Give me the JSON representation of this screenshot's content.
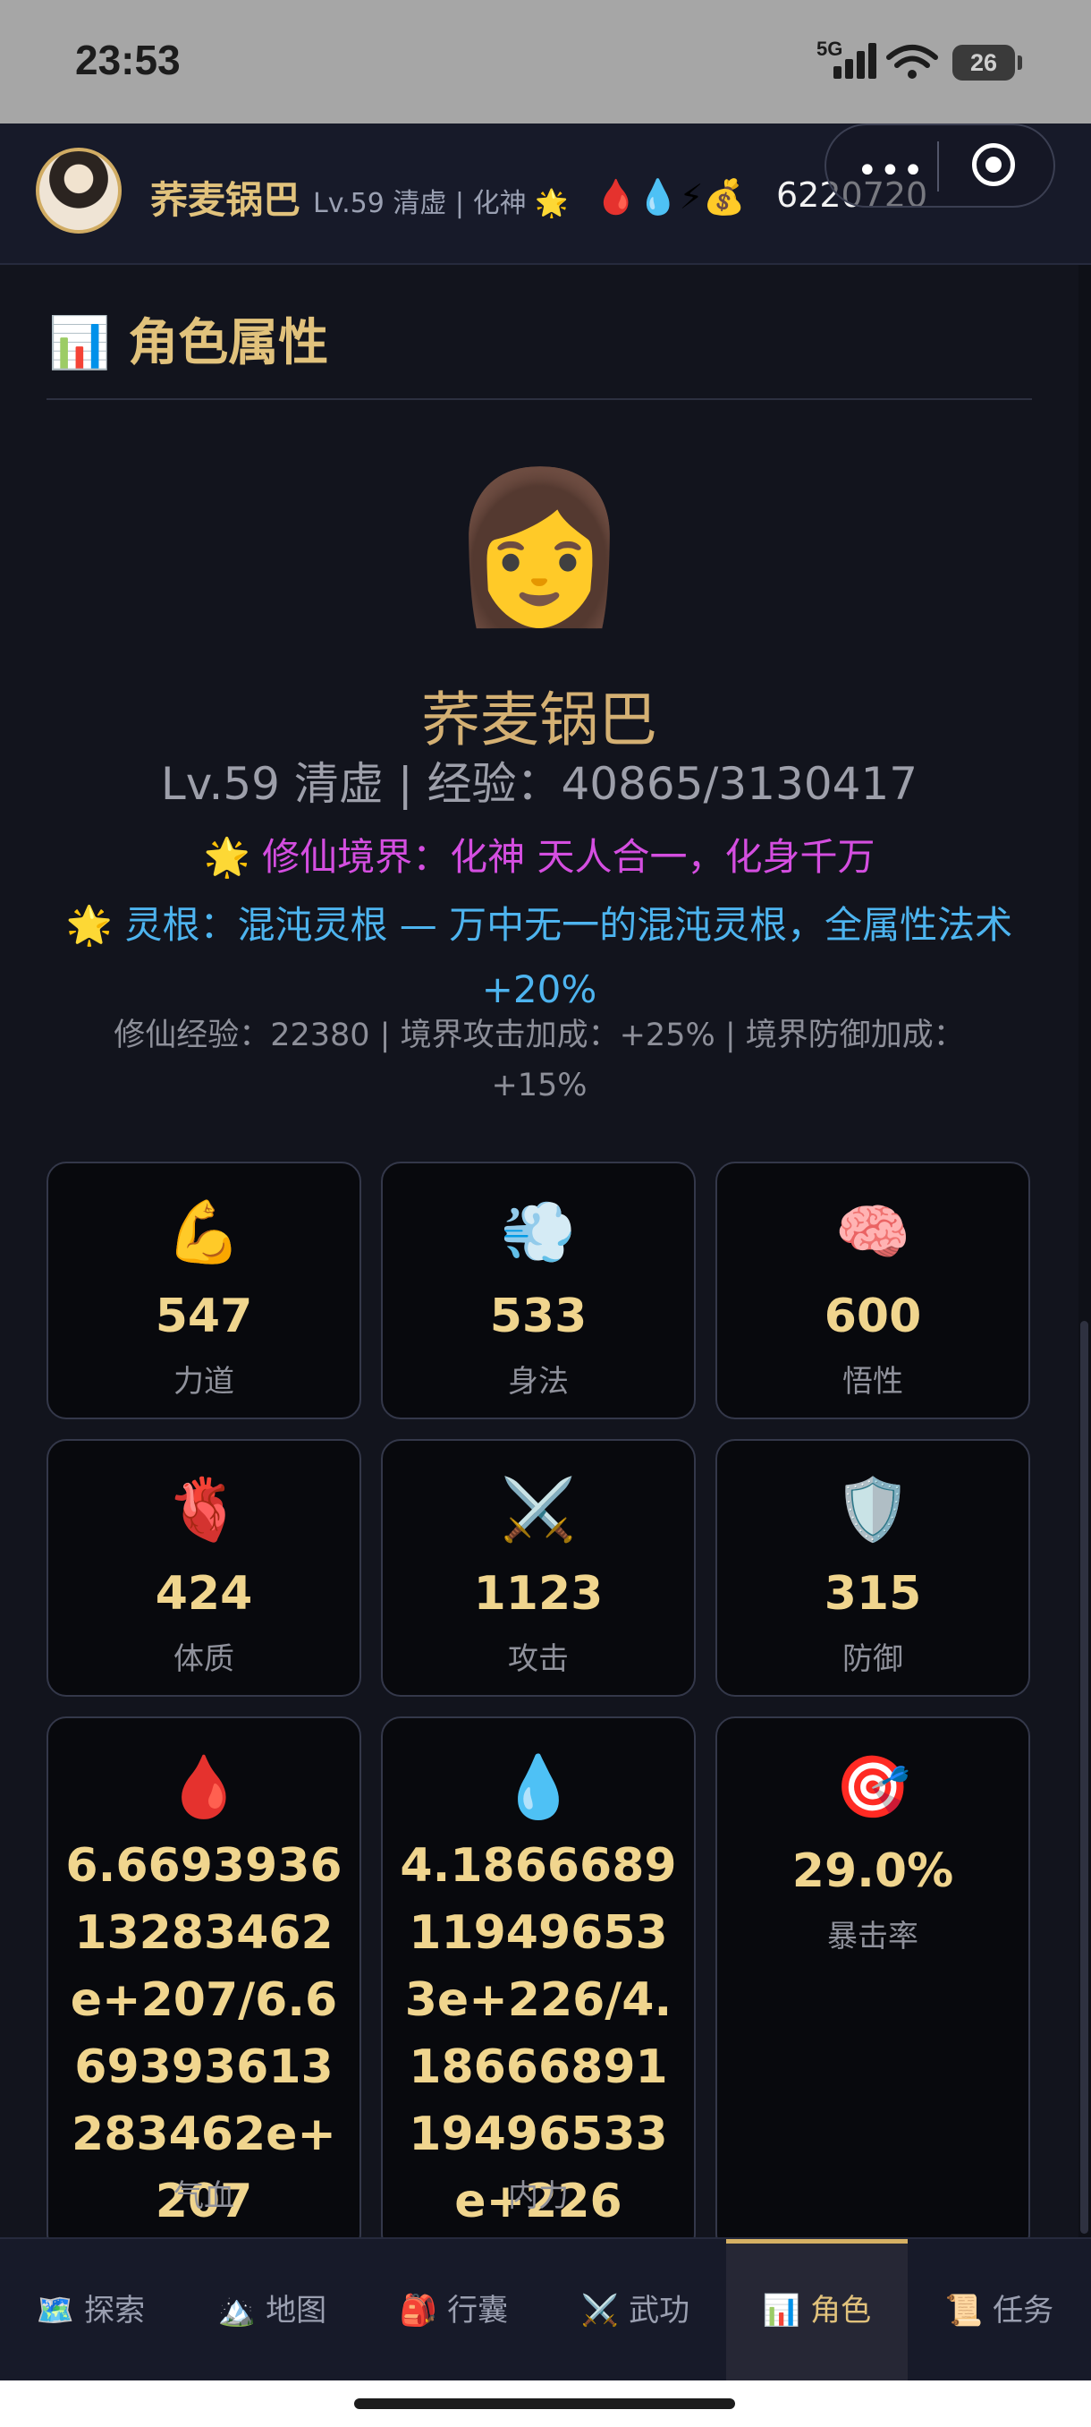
{
  "status_bar": {
    "time": "23:53",
    "network": "5G",
    "battery": "26"
  },
  "header": {
    "player_name": "荞麦锅巴",
    "player_level": "Lv.59 清虚 | 化神 🌟",
    "stat_icons": "🩸💧⚡💰",
    "gold": "6220720"
  },
  "section": {
    "title": "📊 角色属性"
  },
  "character": {
    "emoji": "👩",
    "name": "荞麦锅巴",
    "level_line": "Lv.59 清虚 | 经验：40865/3130417",
    "realm_line": "🌟 修仙境界：化神 天人合一，化身千万",
    "root_line": "🌟 灵根：混沌灵根 — 万中无一的混沌灵根，全属性法术+20%",
    "cultivation_info": "修仙经验：22380 | 境界攻击加成：+25% | 境界防御加成：+15%"
  },
  "stats": {
    "strength": {
      "icon": "💪",
      "value": "547",
      "label": "力道"
    },
    "agility": {
      "icon": "💨",
      "value": "533",
      "label": "身法"
    },
    "insight": {
      "icon": "🧠",
      "value": "600",
      "label": "悟性"
    },
    "constitution": {
      "icon": "🫀",
      "value": "424",
      "label": "体质"
    },
    "attack": {
      "icon": "⚔️",
      "value": "1123",
      "label": "攻击"
    },
    "defense": {
      "icon": "🛡️",
      "value": "315",
      "label": "防御"
    },
    "hp": {
      "icon": "🩸",
      "value": "6.669393613283462e+207/6.669393613283462e+207",
      "label": "气血"
    },
    "mp": {
      "icon": "💧",
      "value": "4.1866689119496533e+226/4.1866689119496533e+226",
      "label": "内力"
    },
    "crit": {
      "icon": "🎯",
      "value": "29.0%",
      "label": "暴击率"
    }
  },
  "nav": [
    {
      "icon": "🗺️",
      "label": "探索"
    },
    {
      "icon": "🏔️",
      "label": "地图"
    },
    {
      "icon": "🎒",
      "label": "行囊"
    },
    {
      "icon": "⚔️",
      "label": "武功"
    },
    {
      "icon": "📊",
      "label": "角色"
    },
    {
      "icon": "📜",
      "label": "任务"
    }
  ],
  "colors": {
    "accent_gold": "#e1c27c",
    "realm_magenta": "#d44ee0",
    "root_blue": "#4db4ef",
    "background": "#12141d"
  }
}
